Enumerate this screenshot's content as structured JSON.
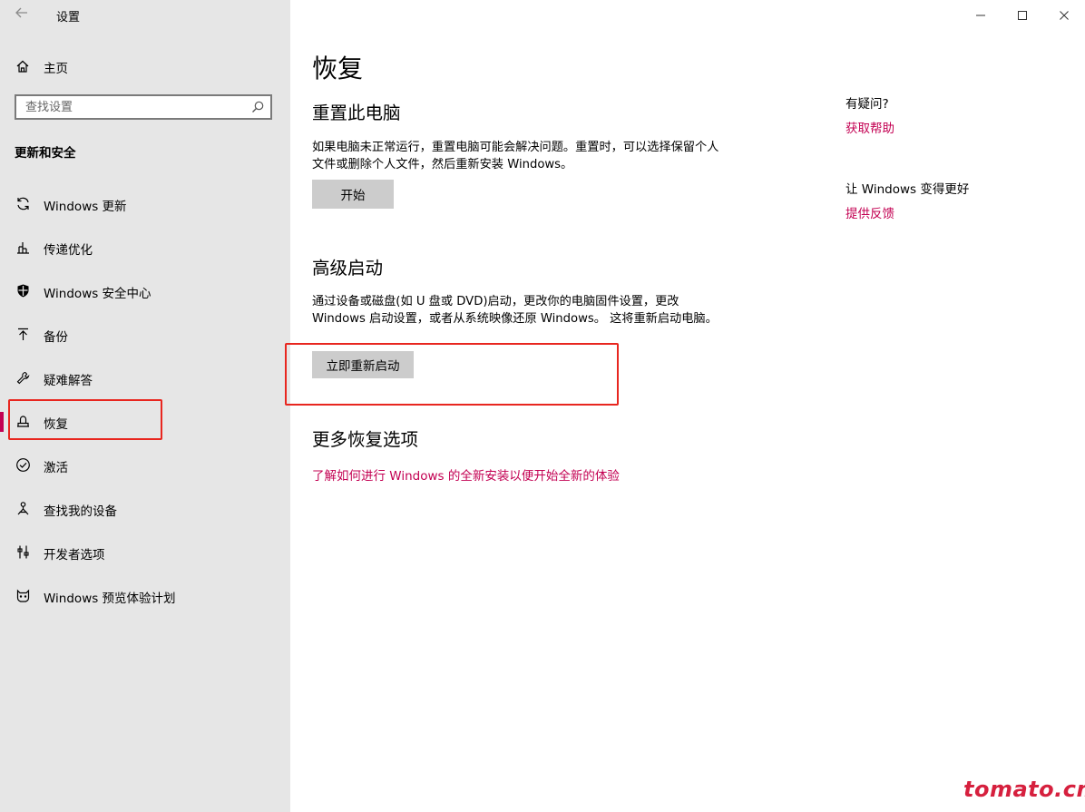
{
  "window": {
    "title": "设置",
    "controls": [
      "minimize",
      "maximize",
      "close"
    ]
  },
  "sidebar": {
    "home_label": "主页",
    "search_placeholder": "查找设置",
    "section_heading": "更新和安全",
    "items": [
      {
        "label": "Windows 更新",
        "icon": "sync-icon"
      },
      {
        "label": "传递优化",
        "icon": "delivery-optimization-icon"
      },
      {
        "label": "Windows 安全中心",
        "icon": "shield-icon"
      },
      {
        "label": "备份",
        "icon": "backup-arrow-icon"
      },
      {
        "label": "疑难解答",
        "icon": "wrench-icon"
      },
      {
        "label": "恢复",
        "icon": "recovery-icon",
        "selected": true
      },
      {
        "label": "激活",
        "icon": "check-circle-icon"
      },
      {
        "label": "查找我的设备",
        "icon": "find-device-icon"
      },
      {
        "label": "开发者选项",
        "icon": "developer-tools-icon"
      },
      {
        "label": "Windows 预览体验计划",
        "icon": "insider-cat-icon"
      }
    ]
  },
  "main": {
    "title": "恢复",
    "reset": {
      "heading": "重置此电脑",
      "description": "如果电脑未正常运行，重置电脑可能会解决问题。重置时，可以选择保留个人文件或删除个人文件，然后重新安装 Windows。",
      "button": "开始"
    },
    "advanced": {
      "heading": "高级启动",
      "description": "通过设备或磁盘(如 U 盘或 DVD)启动，更改你的电脑固件设置，更改 Windows 启动设置，或者从系统映像还原 Windows。 这将重新启动电脑。",
      "button": "立即重新启动"
    },
    "more": {
      "heading": "更多恢复选项",
      "link": "了解如何进行 Windows 的全新安装以便开始全新的体验"
    }
  },
  "aside": {
    "question": "有疑问?",
    "help_link": "获取帮助",
    "improve": "让 Windows 变得更好",
    "feedback_link": "提供反馈"
  },
  "watermark": "tomato.cm",
  "colors": {
    "accent": "#c30052",
    "highlight_box": "#e8261f",
    "sidebar_bg": "#e6e6e6",
    "button_bg": "#cccccc"
  }
}
